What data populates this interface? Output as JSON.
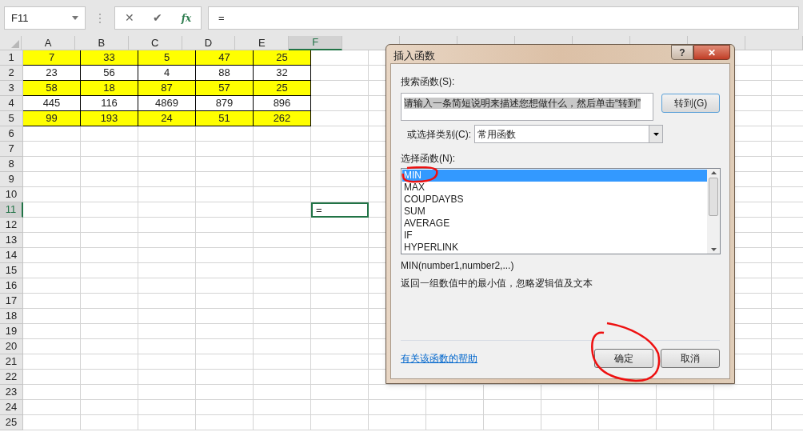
{
  "formula_bar": {
    "name_box": "F11",
    "cancel": "✕",
    "enter": "✔",
    "function": "fx",
    "formula": "="
  },
  "columns": [
    {
      "label": "A",
      "selected": false
    },
    {
      "label": "B",
      "selected": false
    },
    {
      "label": "C",
      "selected": false
    },
    {
      "label": "D",
      "selected": false
    },
    {
      "label": "E",
      "selected": false
    },
    {
      "label": "F",
      "selected": true
    }
  ],
  "rows": [
    {
      "label": "1",
      "selected": false,
      "highlighted": true,
      "cells": [
        "7",
        "33",
        "5",
        "47",
        "25"
      ]
    },
    {
      "label": "2",
      "selected": false,
      "highlighted": false,
      "cells": [
        "23",
        "56",
        "4",
        "88",
        "32"
      ]
    },
    {
      "label": "3",
      "selected": false,
      "highlighted": true,
      "cells": [
        "58",
        "18",
        "87",
        "57",
        "25"
      ]
    },
    {
      "label": "4",
      "selected": false,
      "highlighted": false,
      "cells": [
        "445",
        "116",
        "4869",
        "879",
        "896"
      ]
    },
    {
      "label": "5",
      "selected": false,
      "highlighted": true,
      "cells": [
        "99",
        "193",
        "24",
        "51",
        "262"
      ]
    },
    {
      "label": "6",
      "selected": false
    },
    {
      "label": "7",
      "selected": false
    },
    {
      "label": "8",
      "selected": false
    },
    {
      "label": "9",
      "selected": false
    },
    {
      "label": "10",
      "selected": false
    },
    {
      "label": "11",
      "selected": true,
      "active_value": "="
    },
    {
      "label": "12",
      "selected": false
    },
    {
      "label": "13",
      "selected": false
    },
    {
      "label": "14",
      "selected": false
    },
    {
      "label": "15",
      "selected": false
    },
    {
      "label": "16",
      "selected": false
    },
    {
      "label": "17",
      "selected": false
    },
    {
      "label": "18",
      "selected": false
    },
    {
      "label": "19",
      "selected": false
    },
    {
      "label": "20",
      "selected": false
    },
    {
      "label": "21",
      "selected": false
    },
    {
      "label": "22",
      "selected": false
    },
    {
      "label": "23",
      "selected": false
    },
    {
      "label": "24",
      "selected": false
    },
    {
      "label": "25",
      "selected": false
    }
  ],
  "dialog": {
    "title": "插入函数",
    "help": "?",
    "close": "✕",
    "search_label": "搜索函数(S):",
    "search_value": "请输入一条简短说明来描述您想做什么，然后单击“转到”",
    "go_button": "转到(G)",
    "category_label": "或选择类别(C):",
    "category_value": "常用函数",
    "list_label": "选择函数(N):",
    "functions": [
      {
        "name": "MIN",
        "selected": true
      },
      {
        "name": "MAX",
        "selected": false
      },
      {
        "name": "COUPDAYBS",
        "selected": false
      },
      {
        "name": "SUM",
        "selected": false
      },
      {
        "name": "AVERAGE",
        "selected": false
      },
      {
        "name": "IF",
        "selected": false
      },
      {
        "name": "HYPERLINK",
        "selected": false
      }
    ],
    "syntax": "MIN(number1,number2,...)",
    "description": "返回一组数值中的最小值，忽略逻辑值及文本",
    "help_link": "有关该函数的帮助",
    "ok_button": "确定",
    "cancel_button": "取消"
  }
}
